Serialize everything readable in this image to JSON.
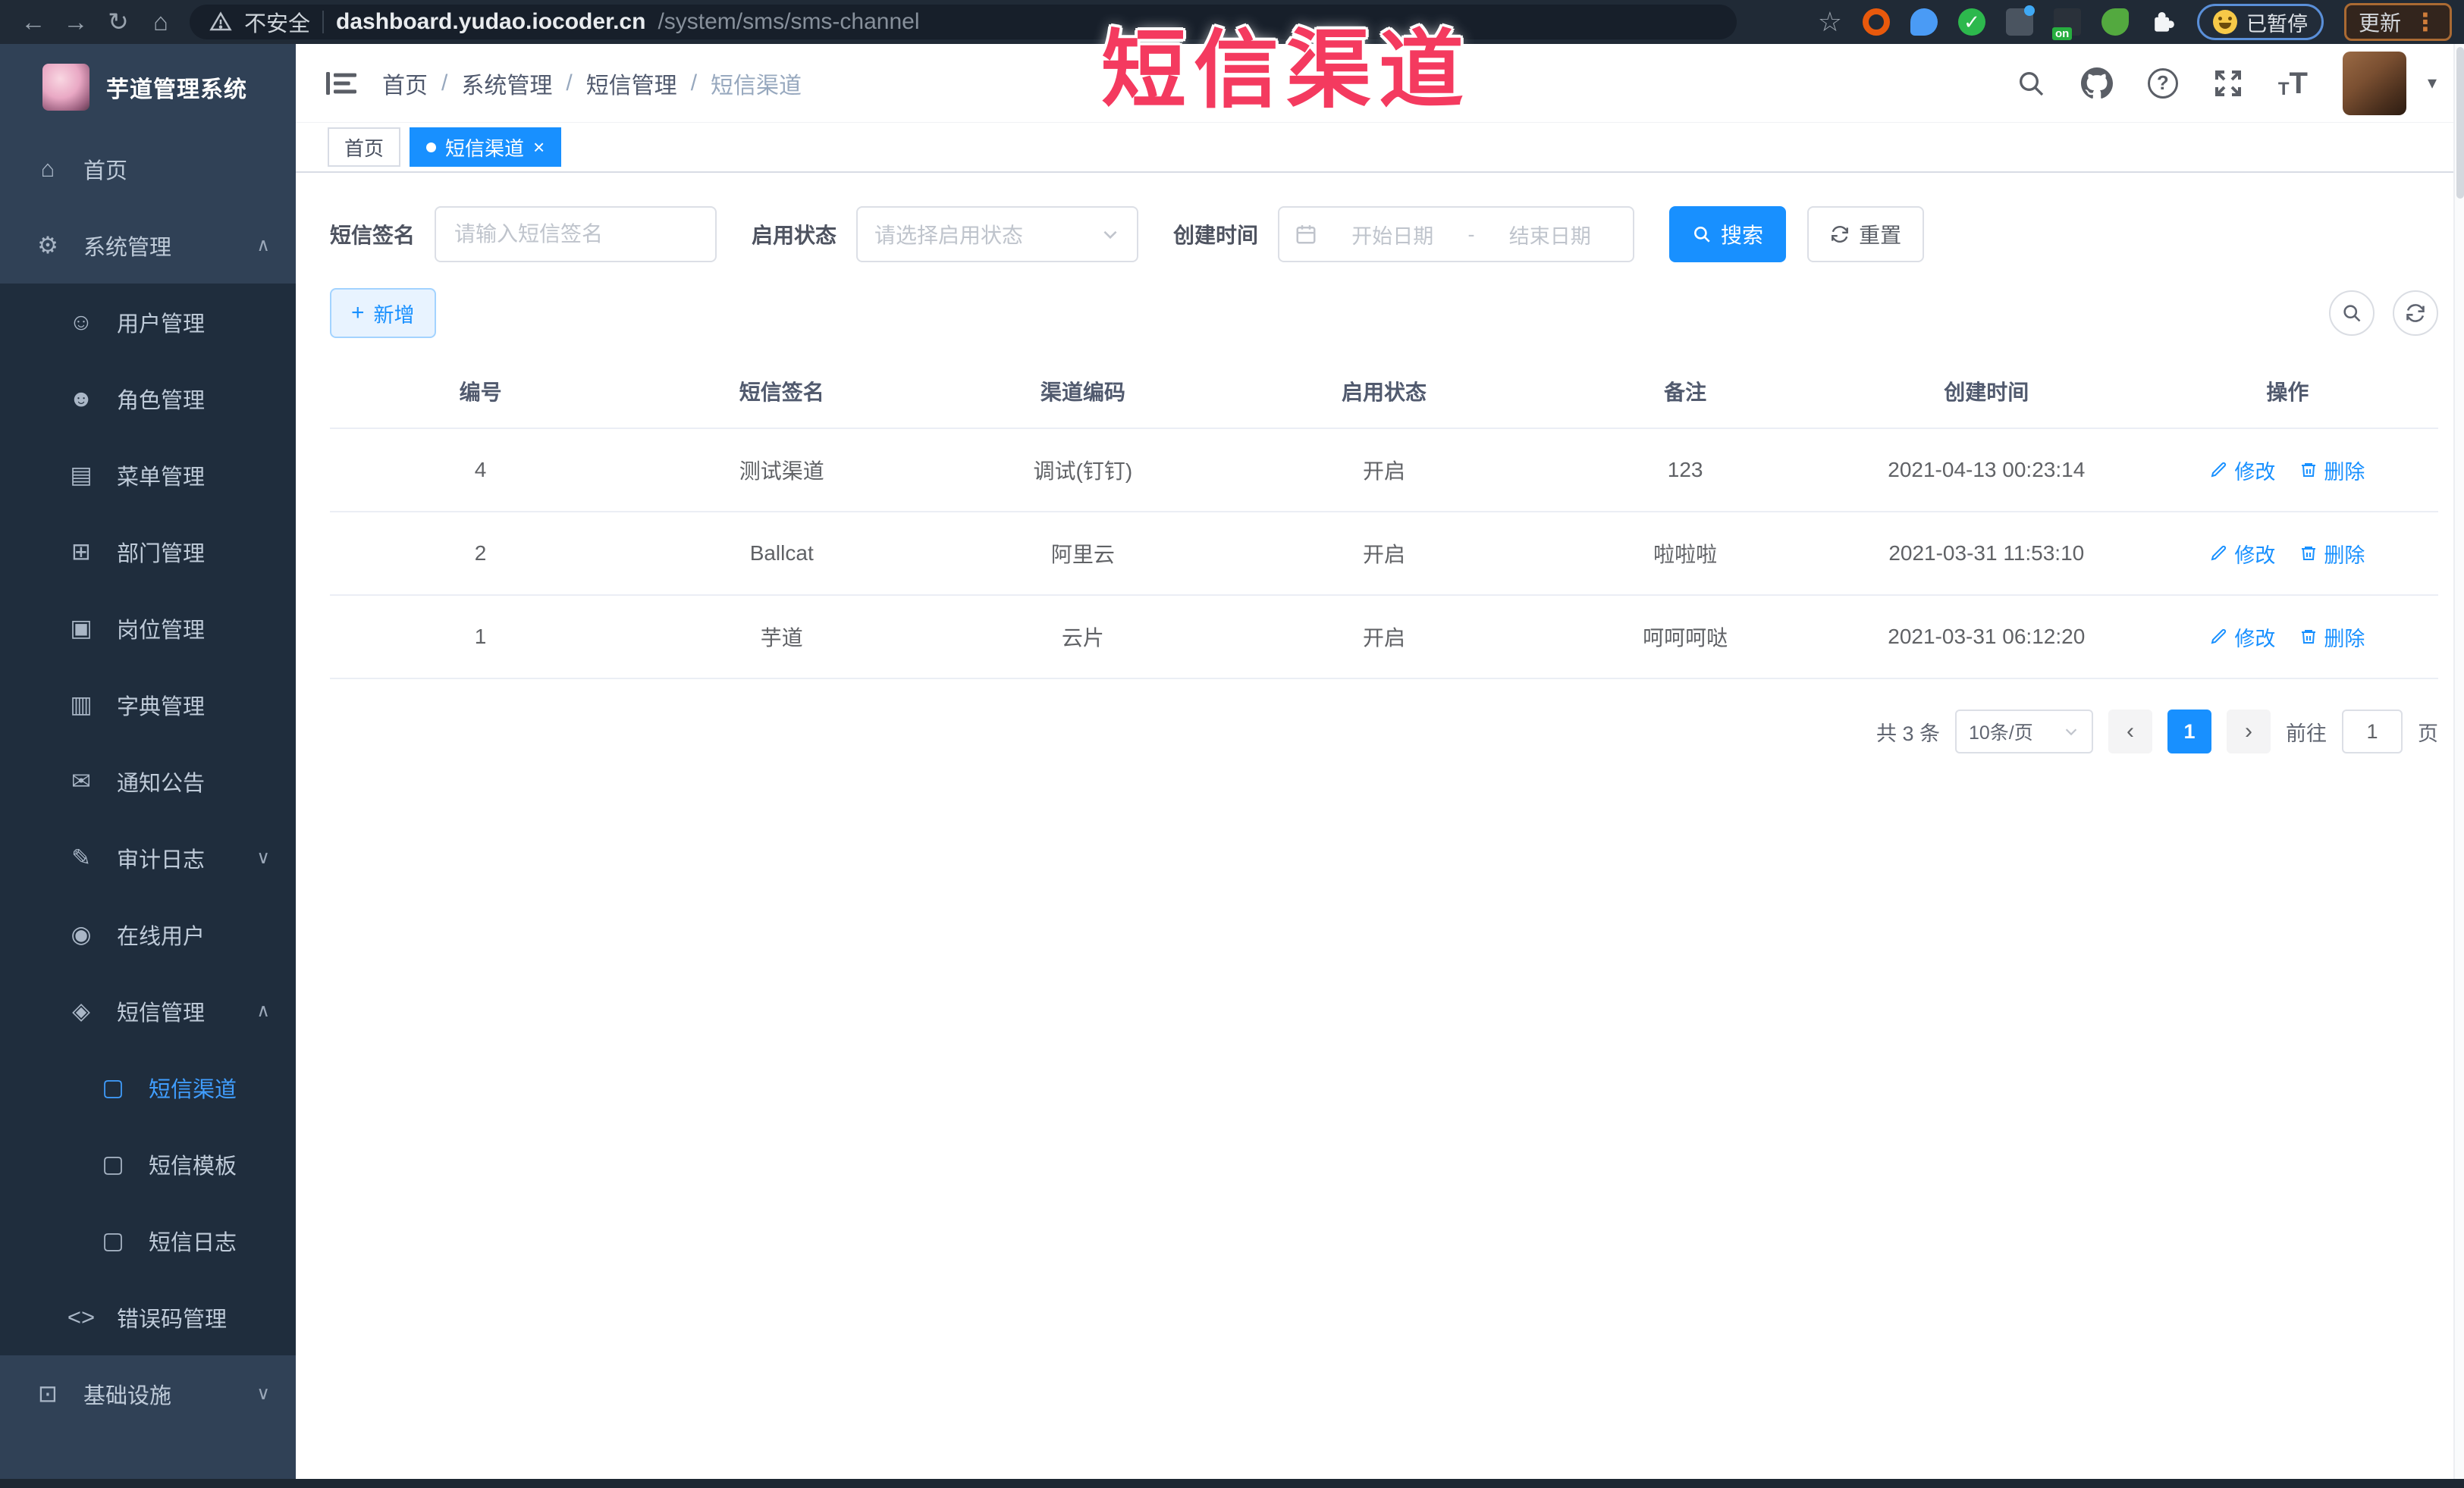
{
  "browser": {
    "security_label": "不安全",
    "url_domain": "dashboard.yudao.iocoder.cn",
    "url_path": "/system/sms/sms-channel",
    "paused_label": "已暂停",
    "update_label": "更新",
    "ext_on_badge": "on"
  },
  "overlay_title": "短信渠道",
  "icons": {
    "back": "←",
    "forward": "→",
    "reload": "↻",
    "home": "⌂",
    "star": "☆",
    "menu_dots": "⋮",
    "check": "✓",
    "question_mark": "?",
    "caret_up": "∧",
    "caret_down": "∨",
    "avatar_caret": "▾",
    "chevron_left": "‹",
    "chevron_right": "›",
    "plus": "+",
    "date_dash": "-",
    "close": "×",
    "font_small": "T",
    "font_big": "T"
  },
  "sidebar": {
    "logo_title": "芋道管理系统",
    "items": [
      {
        "label": "首页",
        "icon": "⌂"
      },
      {
        "label": "系统管理",
        "icon": "⚙",
        "caret": "∧"
      },
      {
        "label": "用户管理",
        "icon": "☺"
      },
      {
        "label": "角色管理",
        "icon": "☻"
      },
      {
        "label": "菜单管理",
        "icon": "▤"
      },
      {
        "label": "部门管理",
        "icon": "⊞"
      },
      {
        "label": "岗位管理",
        "icon": "▣"
      },
      {
        "label": "字典管理",
        "icon": "▥"
      },
      {
        "label": "通知公告",
        "icon": "✉"
      },
      {
        "label": "审计日志",
        "icon": "✎",
        "caret": "∨"
      },
      {
        "label": "在线用户",
        "icon": "◉"
      },
      {
        "label": "短信管理",
        "icon": "◈",
        "caret": "∧"
      },
      {
        "label": "短信渠道",
        "icon": "▢"
      },
      {
        "label": "短信模板",
        "icon": "▢"
      },
      {
        "label": "短信日志",
        "icon": "▢"
      },
      {
        "label": "错误码管理",
        "icon": "<>"
      },
      {
        "label": "基础设施",
        "icon": "⊡",
        "caret": "∨"
      }
    ]
  },
  "breadcrumb": {
    "items": [
      "首页",
      "系统管理",
      "短信管理",
      "短信渠道"
    ],
    "separator": "/"
  },
  "tags": {
    "home": "首页",
    "current": "短信渠道"
  },
  "filters": {
    "sign_label": "短信签名",
    "sign_placeholder": "请输入短信签名",
    "status_label": "启用状态",
    "status_placeholder": "请选择启用状态",
    "date_label": "创建时间",
    "date_start": "开始日期",
    "date_end": "结束日期",
    "search_label": "搜索",
    "reset_label": "重置"
  },
  "toolbar": {
    "add_label": "新增"
  },
  "table": {
    "headers": [
      "编号",
      "短信签名",
      "渠道编码",
      "启用状态",
      "备注",
      "创建时间",
      "操作"
    ],
    "rows": [
      {
        "id": "4",
        "sign": "测试渠道",
        "code": "调试(钉钉)",
        "status": "开启",
        "remark": "123",
        "created": "2021-04-13 00:23:14"
      },
      {
        "id": "2",
        "sign": "Ballcat",
        "code": "阿里云",
        "status": "开启",
        "remark": "啦啦啦",
        "created": "2021-03-31 11:53:10"
      },
      {
        "id": "1",
        "sign": "芋道",
        "code": "云片",
        "status": "开启",
        "remark": "呵呵呵哒",
        "created": "2021-03-31 06:12:20"
      }
    ],
    "edit_label": "修改",
    "delete_label": "删除"
  },
  "pagination": {
    "total": "共 3 条",
    "page_size": "10条/页",
    "current_page": "1",
    "goto_label": "前往",
    "goto_value": "1",
    "page_unit": "页"
  },
  "colors": {
    "primary": "#1890ff",
    "menu_active": "#409eff",
    "overlay_red": "#f43a5f"
  }
}
